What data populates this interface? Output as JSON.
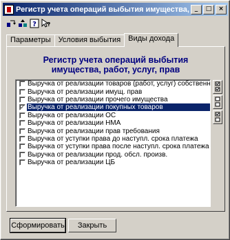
{
  "window": {
    "title": "Регистр учета операций выбытия имущества, ..."
  },
  "title_buttons": [
    "_",
    "□",
    "×"
  ],
  "toolbar": [
    {
      "icon": "refresh-icon",
      "glyph": "⟲"
    },
    {
      "icon": "open-icon",
      "glyph": "⇪"
    },
    {
      "icon": "help-icon",
      "glyph": "?"
    },
    {
      "icon": "context-help-icon",
      "glyph": "↖"
    }
  ],
  "tabs": [
    {
      "label": "Параметры",
      "active": false
    },
    {
      "label": "Условия выбытия",
      "active": false
    },
    {
      "label": "Виды дохода",
      "active": true
    }
  ],
  "heading": {
    "line1": "Регистр учета операций выбытия",
    "line2": "имущества, работ, услуг, прав"
  },
  "items": [
    {
      "label": "Выручка от реализации товаров (работ, услуг) собственно",
      "checked": false,
      "selected": false
    },
    {
      "label": "Выручка от реализации имущ. прав",
      "checked": false,
      "selected": false
    },
    {
      "label": "Выручка от реализации прочего имущества",
      "checked": false,
      "selected": false
    },
    {
      "label": "Выручка от реализации покупных товаров",
      "checked": true,
      "selected": true
    },
    {
      "label": "Выручка от реализации ОС",
      "checked": false,
      "selected": false
    },
    {
      "label": "Выручка от реализации НМА",
      "checked": false,
      "selected": false
    },
    {
      "label": "Выручка от реализации прав требования",
      "checked": false,
      "selected": false
    },
    {
      "label": "Выручка от уступки права до наступл. срока платежа",
      "checked": false,
      "selected": false
    },
    {
      "label": "Выручка от уступки права после наступл. срока платежа",
      "checked": false,
      "selected": false
    },
    {
      "label": "Выручка от реализации прод. обсл. произв.",
      "checked": false,
      "selected": false
    },
    {
      "label": "Выручка от реализации ЦБ",
      "checked": false,
      "selected": false
    }
  ],
  "buttons": {
    "generate": "Сформировать",
    "close": "Закрыть"
  }
}
